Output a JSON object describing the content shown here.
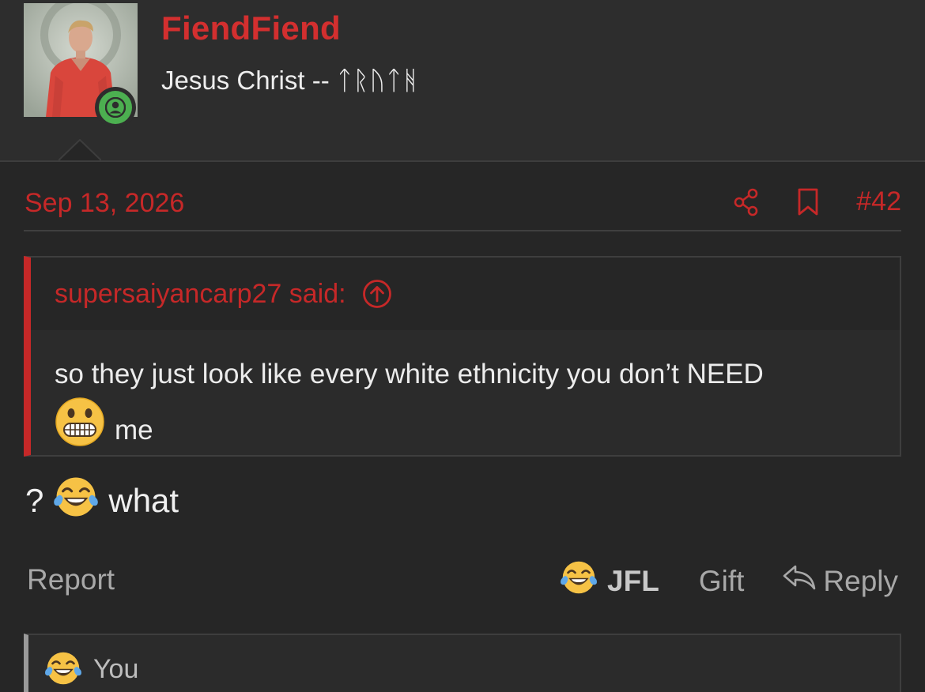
{
  "user": {
    "name": "FiendFiend",
    "title_prefix": "Jesus Christ -- ",
    "title_runes": "ᛏᚱᚢᛏᚻ",
    "online": true
  },
  "post": {
    "date": "Sep 13, 2026",
    "number": "#42",
    "quote": {
      "author_said": "supersaiyancarp27 said:",
      "text_line1": "so they just look like every white ethnicity you don’t NEED",
      "text_line2": "me",
      "emoji": "grimacing-face"
    },
    "body_prefix": "?",
    "body_text": "what",
    "body_emoji": "face-with-tears-of-joy"
  },
  "actions": {
    "report": "Report",
    "reaction_label": "JFL",
    "gift": "Gift",
    "reply": "Reply"
  },
  "reactions": {
    "text": "You",
    "emoji": "face-with-tears-of-joy"
  },
  "colors": {
    "accent": "#c62828",
    "background": "#262626",
    "online": "#4caf50"
  }
}
